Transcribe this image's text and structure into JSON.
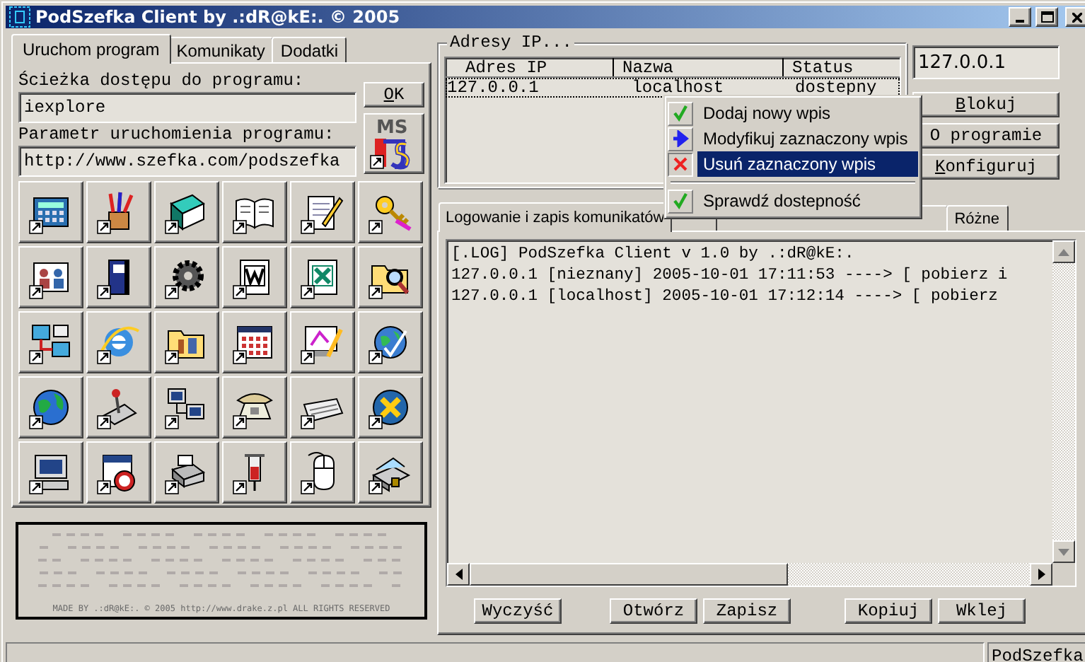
{
  "window": {
    "title": "PodSzefka Client by .:dR@kE:. © 2005"
  },
  "left_tabs": [
    {
      "label": "Uruchom program",
      "selected": true
    },
    {
      "label": "Komunikaty",
      "selected": false
    },
    {
      "label": "Dodatki",
      "selected": false
    }
  ],
  "path_label": "Ścieżka dostępu do programu:",
  "path_field": {
    "value": "iexplore"
  },
  "ok_button": {
    "label": "OK",
    "mnemonic": true
  },
  "param_label": "Parametr uruchomienia programu:",
  "param_field": {
    "value": "http://www.szefka.com/podszefka"
  },
  "ms_button": {
    "label": "MS"
  },
  "credits": "MADE BY .:dR@kE:. © 2005 http://www.drake.z.pl ALL RIGHTS RESERVED",
  "ip_group": {
    "title": "Adresy IP...",
    "columns": [
      "Adres IP",
      "Nazwa",
      "Status"
    ],
    "rows": [
      {
        "cells": [
          "127.0.0.1",
          "localhost",
          "dostepny"
        ],
        "selected": false
      }
    ]
  },
  "ip_field": {
    "value": "127.0.0.1"
  },
  "side_buttons": [
    {
      "label": "Blokuj",
      "mnemonic": true
    },
    {
      "label": "O programie",
      "mnemonic": false
    },
    {
      "label": "Konfiguruj",
      "mnemonic": true
    }
  ],
  "context_menu": [
    {
      "kind": "check",
      "label": "Dodaj nowy wpis",
      "selected": false
    },
    {
      "kind": "arrow",
      "label": "Modyfikuj zaznaczony wpis",
      "selected": false
    },
    {
      "kind": "cross",
      "label": "Usuń zaznaczony wpis",
      "selected": true
    },
    {
      "kind": "separator"
    },
    {
      "kind": "check",
      "label": "Sprawdź dostepność",
      "selected": false
    }
  ],
  "log_tabs": [
    {
      "label": "Logowanie i zapis komunikatów",
      "selected": true
    },
    {
      "selected": false
    },
    {
      "selected": false
    },
    {
      "label": "Różne",
      "selected": false
    }
  ],
  "log_lines": [
    "[.LOG] PodSzefka Client v 1.0 by .:dR@kE:.",
    "127.0.0.1 [nieznany] 2005-10-01 17:11:53 ----> [ pobierz i",
    "127.0.0.1 [localhost] 2005-10-01 17:12:14 ----> [ pobierz"
  ],
  "log_buttons": [
    {
      "label": "Wyczyść"
    },
    {
      "label": "Otwórz"
    },
    {
      "label": "Zapisz"
    },
    {
      "label": "Kopiuj"
    },
    {
      "label": "Wklej"
    }
  ],
  "status_bar": {
    "text": "PodSzefka"
  }
}
